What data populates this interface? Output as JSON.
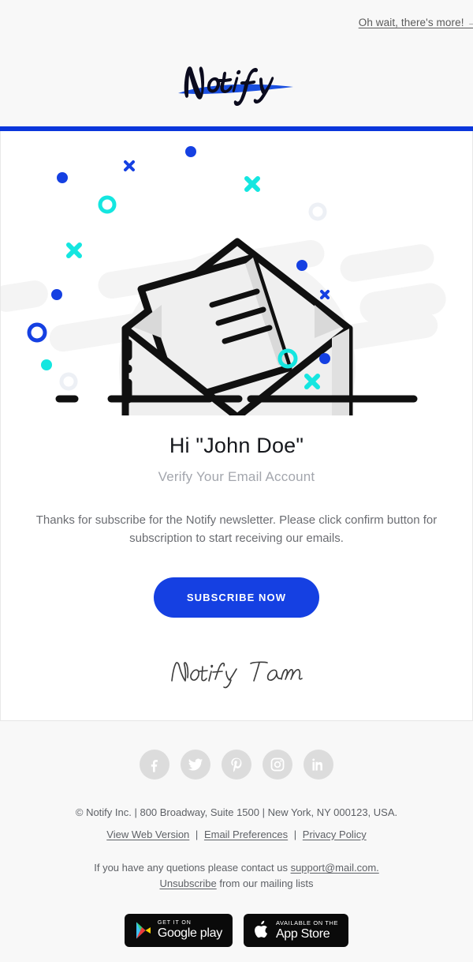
{
  "theme": {
    "accent_blue": "#1540e2",
    "rule_blue": "#0a36dc",
    "cyan": "#14e6e0",
    "page_bg": "#f8f8f8",
    "card_bg": "#ffffff",
    "muted_text": "#6b6d72",
    "social_bg": "#dcdcdc"
  },
  "header": {
    "preheader_link": "Oh wait, there's more! →",
    "logo_text": "Notify"
  },
  "hero": {
    "illustration_name": "open-envelope-with-letter"
  },
  "main": {
    "greeting": "Hi \"John Doe\"",
    "subtitle": "Verify Your Email Account",
    "body": "Thanks for subscribe for the Notify newsletter. Please click confirm button for subscription to start receiving our emails.",
    "cta_label": "SUBSCRIBE NOW",
    "signature": "Notify Team"
  },
  "footer": {
    "social": [
      {
        "name": "facebook",
        "label": "Facebook"
      },
      {
        "name": "twitter",
        "label": "Twitter"
      },
      {
        "name": "pinterest",
        "label": "Pinterest"
      },
      {
        "name": "instagram",
        "label": "Instagram"
      },
      {
        "name": "linkedin",
        "label": "LinkedIn"
      }
    ],
    "address": "© Notify Inc. | 800 Broadway, Suite 1500 | New York, NY 000123, USA.",
    "links": [
      {
        "label": "View Web Version"
      },
      {
        "label": "Email Preferences"
      },
      {
        "label": "Privacy Policy"
      }
    ],
    "link_separator": "|",
    "contact_prefix": "If you have any quetions please contact us ",
    "contact_email": "support@mail.com.",
    "unsubscribe_link": "Unsubscribe",
    "unsubscribe_suffix": " from our mailing lists",
    "stores": {
      "google": {
        "top": "GET IT ON",
        "bottom": "Google play"
      },
      "apple": {
        "top": "Available on the",
        "bottom": "App Store"
      }
    }
  }
}
